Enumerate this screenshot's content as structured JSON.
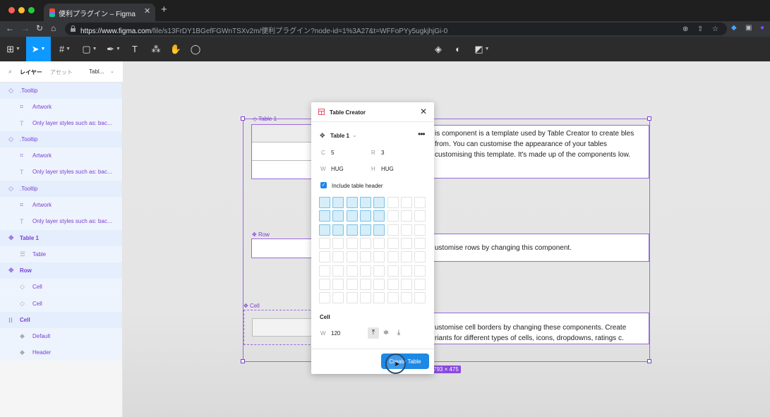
{
  "browser": {
    "tab_title": "便利プラグイン – Figma",
    "url_host": "https://www.figma.com",
    "url_path": "/file/s13FrDY1BGefFGWnTSXv2m/便利プラグイン?node-id=1%3A27&t=WFFoPYy5ugkjhjGi-0",
    "new_tab": "+"
  },
  "toolbar": {
    "text_tool": "T"
  },
  "layers_panel": {
    "tab_layers": "レイヤー",
    "tab_assets": "アセット",
    "page_selector": "Tabl...",
    "rows": [
      {
        "label": ".Tooltip",
        "type": "component"
      },
      {
        "label": "Artwork",
        "type": "frame"
      },
      {
        "label": "Only layer styles such as: bac...",
        "type": "text"
      },
      {
        "label": ".Tooltip",
        "type": "component"
      },
      {
        "label": "Artwork",
        "type": "frame"
      },
      {
        "label": "Only layer styles such as: bac...",
        "type": "text"
      },
      {
        "label": ".Tooltip",
        "type": "component"
      },
      {
        "label": "Artwork",
        "type": "frame"
      },
      {
        "label": "Only layer styles such as: bac...",
        "type": "text"
      },
      {
        "label": "Table 1",
        "type": "component"
      },
      {
        "label": "Table",
        "type": "frame"
      },
      {
        "label": "Row",
        "type": "component"
      },
      {
        "label": "Cell",
        "type": "instance"
      },
      {
        "label": "Cell",
        "type": "instance"
      },
      {
        "label": "Cell",
        "type": "variants"
      },
      {
        "label": "Default",
        "type": "variant"
      },
      {
        "label": "Header",
        "type": "variant"
      }
    ]
  },
  "canvas": {
    "table_label": "Table 1",
    "row_label": "Row",
    "cell_label": "Cell",
    "card1_text": "is component is a template used by Table Creator to create bles from. You can customise the appearance of your tables customising this template. It's made up of the components low.",
    "card2_text": "ustomise rows by changing this component.",
    "card3_text": "ustomise cell borders by changing these components. Create riants for different types of cells, icons, dropdowns, ratings c.",
    "size_badge": "793 × 475"
  },
  "plugin": {
    "title": "Table Creator",
    "table_name": "Table 1",
    "c_label": "C",
    "c_value": "5",
    "r_label": "R",
    "r_value": "3",
    "w_label": "W",
    "w_value": "HUG",
    "h_label": "H",
    "h_value": "HUG",
    "include_header_label": "Include table header",
    "include_header_checked": true,
    "grid": {
      "cols": 8,
      "rows": 8,
      "selected_cols": 5,
      "selected_rows": 3
    },
    "cell_section": "Cell",
    "cell_w_label": "W",
    "cell_w_value": "120",
    "create_button": "Create Table",
    "accent_color": "#1e88e5"
  }
}
